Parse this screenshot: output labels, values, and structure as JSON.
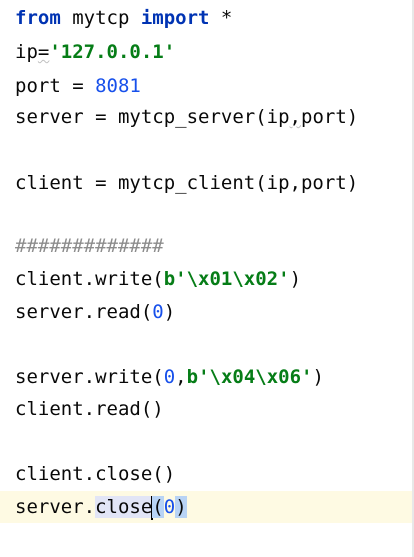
{
  "editor": {
    "lines": {
      "l1": {
        "from": "from",
        "module": " mytcp ",
        "import": "import",
        "star": " *"
      },
      "l2": {
        "var": "ip",
        "eq": "=",
        "value": "'127.0.0.1'"
      },
      "l3": {
        "var": "port = ",
        "value": "8081"
      },
      "l4": {
        "text": "server = mytcp_server(ip",
        "comma": ",",
        "rest": "port)"
      },
      "l5": {
        "text": "client = mytcp_client(ip,port)"
      },
      "l6": {
        "text": "#############"
      },
      "l7": {
        "pre": "client.write(",
        "bytes": "b'\\x01\\x02'",
        "post": ")"
      },
      "l8": {
        "pre": "server.read(",
        "num": "0",
        "post": ")"
      },
      "l9": {
        "pre": "server.write(",
        "num": "0",
        "comma": ",",
        "bytes": "b'\\x04\\x06'",
        "post": ")"
      },
      "l10": {
        "text": "client.read()"
      },
      "l11": {
        "text": "client.close()"
      },
      "l12": {
        "obj": "server.",
        "method": "close",
        "open": "(",
        "num": "0",
        "close": ")"
      }
    }
  }
}
